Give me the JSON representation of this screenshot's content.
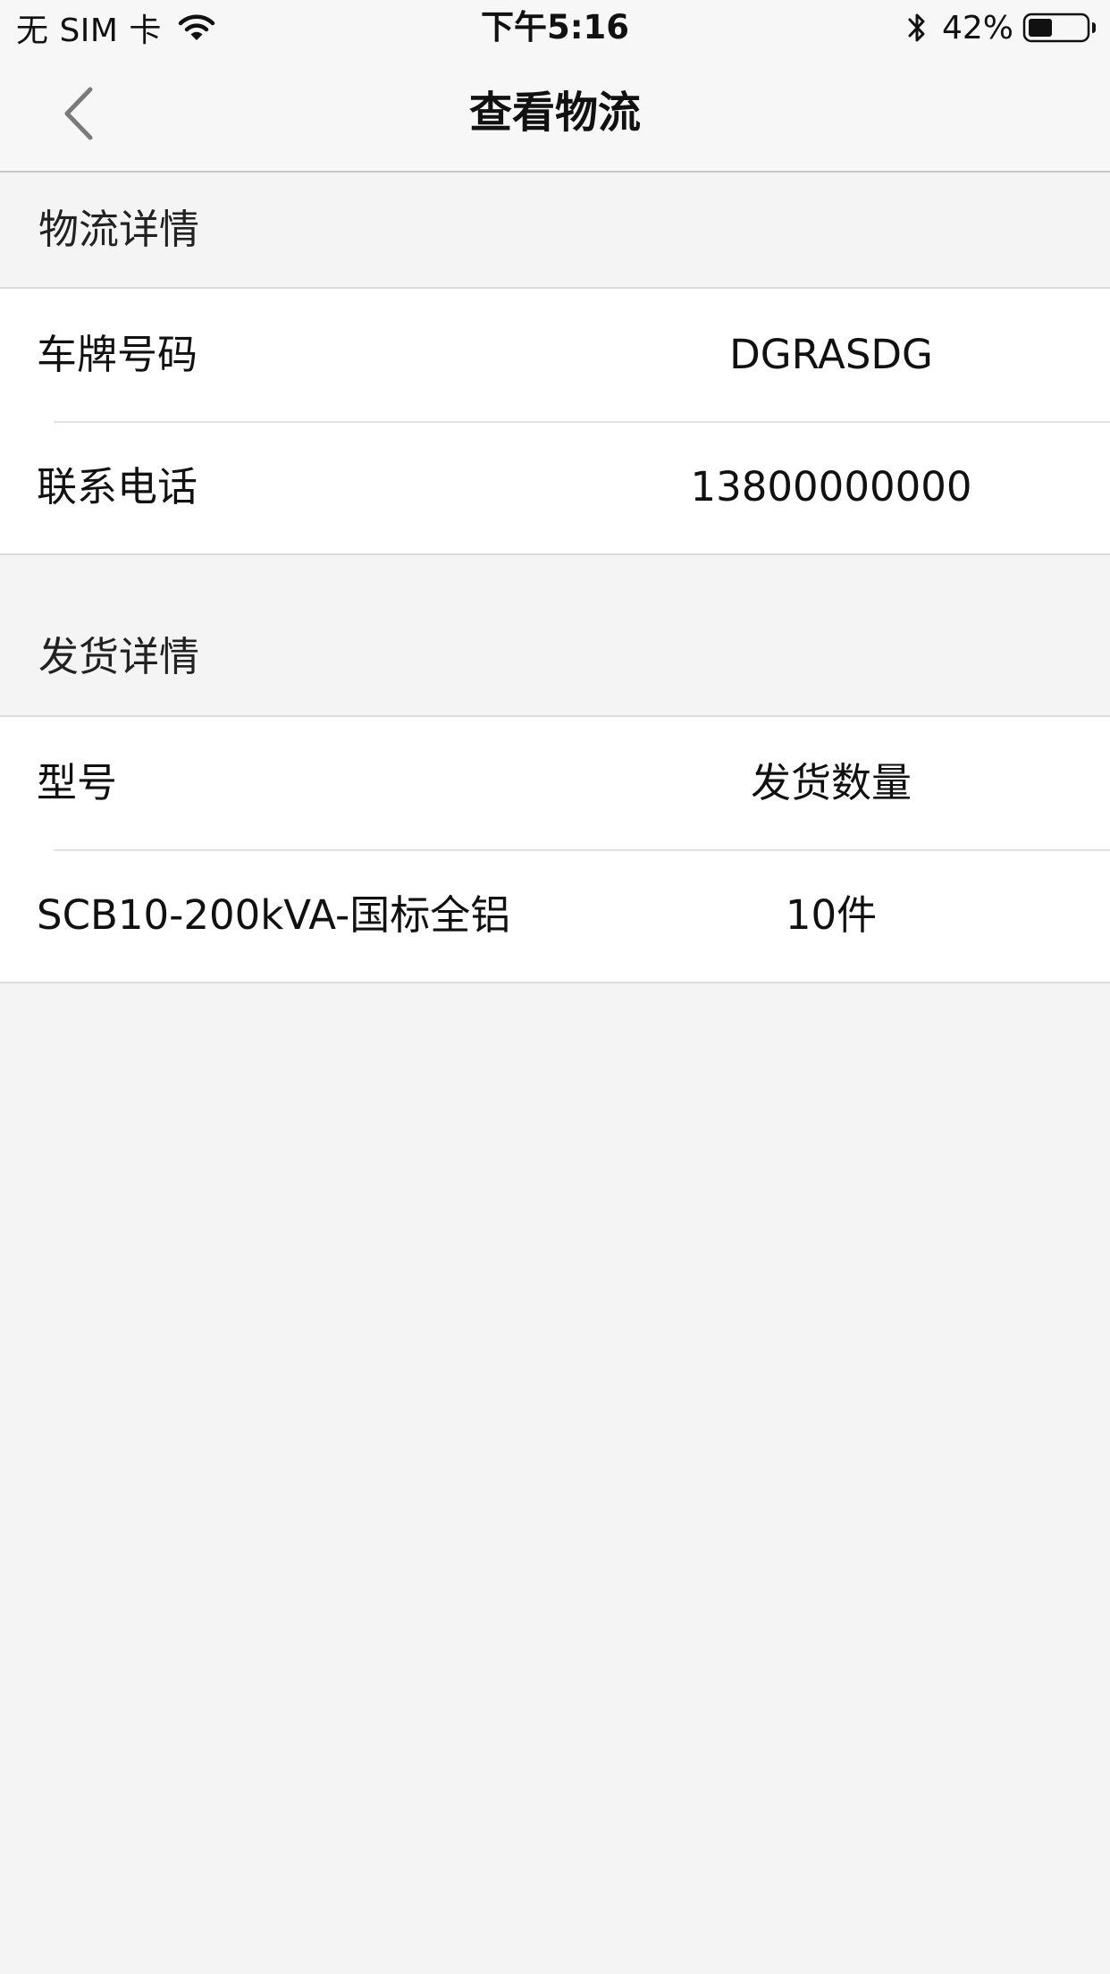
{
  "status_bar": {
    "carrier": "无 SIM 卡",
    "time": "下午5:16",
    "battery_percent": "42%",
    "battery_level": 0.42,
    "icons": [
      "wifi-icon",
      "bluetooth-icon",
      "battery-icon"
    ]
  },
  "nav": {
    "title": "查看物流",
    "back_icon": "chevron-left-icon"
  },
  "logistics": {
    "header": "物流详情",
    "rows": [
      {
        "label": "车牌号码",
        "value": "DGRASDG"
      },
      {
        "label": "联系电话",
        "value": "13800000000"
      }
    ]
  },
  "shipment": {
    "header": "发货详情",
    "columns": {
      "model": "型号",
      "quantity": "发货数量"
    },
    "items": [
      {
        "model": "SCB10-200kVA-国标全铝",
        "quantity": "10件"
      }
    ]
  },
  "colors": {
    "background": "#f4f4f4",
    "bar_background": "#f7f7f7",
    "card_background": "#ffffff",
    "separator": "#dcdcdc",
    "text": "#111111"
  }
}
